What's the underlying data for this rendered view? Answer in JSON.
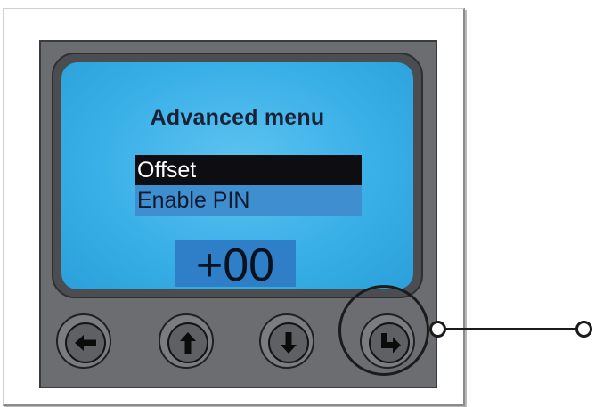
{
  "screen": {
    "title": "Advanced menu",
    "menu_items": [
      {
        "label": "Offset",
        "selected": true
      },
      {
        "label": "Enable PIN",
        "selected": false
      }
    ],
    "value": "+00",
    "background_color": "#3ab0e8",
    "selected_color": "#0d0d12"
  },
  "buttons": [
    {
      "icon": "arrow-left-icon"
    },
    {
      "icon": "arrow-up-icon"
    },
    {
      "icon": "arrow-down-icon"
    },
    {
      "icon": "enter-icon",
      "highlighted": true
    }
  ]
}
